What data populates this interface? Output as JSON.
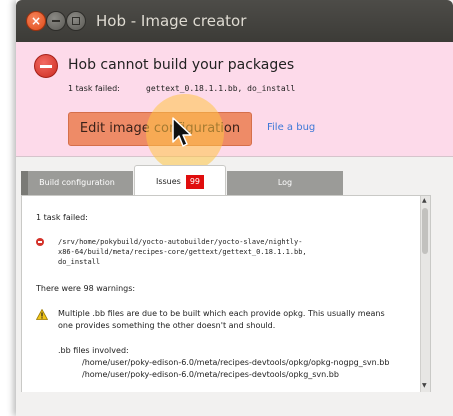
{
  "window": {
    "title": "Hob - Image creator"
  },
  "banner": {
    "title": "Hob cannot build your packages",
    "task_prefix": "1 task failed:",
    "task_name": "gettext_0.18.1.1.bb, do_install",
    "edit_button": "Edit image configuration",
    "bug_link": "File a bug"
  },
  "tabs": {
    "build": "Build configuration",
    "issues": "Issues",
    "issues_count": "99",
    "log": "Log"
  },
  "issues": {
    "task_failed": "1 task failed:",
    "error_lines": [
      "/srv/home/pokybuild/yocto-autobuilder/yocto-slave/nightly-",
      "x86-64/build/meta/recipes-core/gettext/gettext_0.18.1.1.bb,",
      "do_install"
    ],
    "warnings_header": "There were 98 warnings:",
    "warning_lines": [
      "Multiple .bb files are due to be built which each provide opkg. This usually means",
      "one provides something the other doesn't and should."
    ],
    "files_header": ".bb files involved:",
    "files": [
      "/home/user/poky-edison-6.0/meta/recipes-devtools/opkg/opkg-nogpg_svn.bb",
      "/home/user/poky-edison-6.0/meta/recipes-devtools/opkg_svn.bb"
    ]
  },
  "colors": {
    "banner_bg": "#fddaea",
    "button_accent": "#ee8b67",
    "link": "#3d78d7",
    "badge": "#e00d0d"
  }
}
